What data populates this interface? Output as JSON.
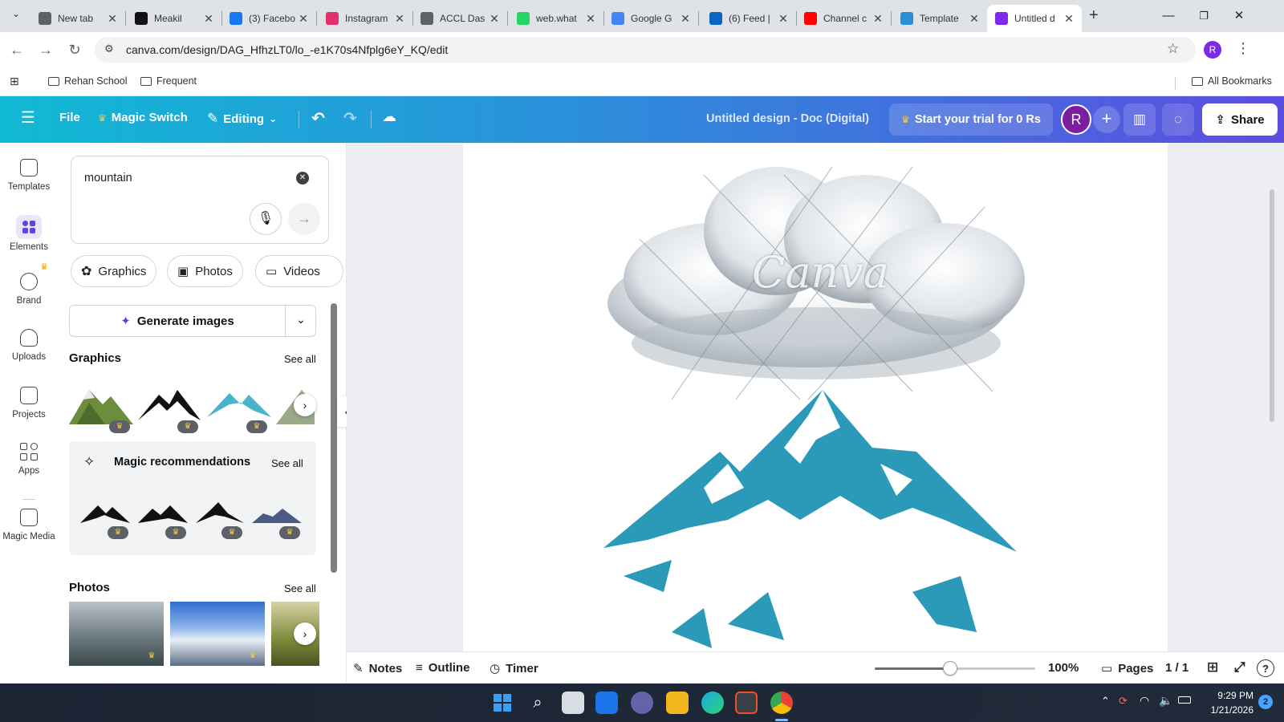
{
  "browser": {
    "tabs": [
      {
        "title": "New tab",
        "color": "#5f6368",
        "icon": "chrome-icon"
      },
      {
        "title": "Meakil",
        "color": "#111111",
        "icon": "meakil-icon"
      },
      {
        "title": "(3) Facebo",
        "color": "#1877f2",
        "icon": "facebook-icon"
      },
      {
        "title": "Instagram",
        "color": "#e1306c",
        "icon": "instagram-icon"
      },
      {
        "title": "ACCL Das",
        "color": "#5f6368",
        "icon": "globe-icon"
      },
      {
        "title": "web.what",
        "color": "#25d366",
        "icon": "whatsapp-icon"
      },
      {
        "title": "Google G",
        "color": "#4285f4",
        "icon": "gemini-icon"
      },
      {
        "title": "(6) Feed |",
        "color": "#0a66c2",
        "icon": "linkedin-icon"
      },
      {
        "title": "Channel c",
        "color": "#ff0000",
        "icon": "youtube-icon"
      },
      {
        "title": "Template",
        "color": "#2a8fd6",
        "icon": "canva-icon"
      },
      {
        "title": "Untitled d",
        "color": "#7d2ae8",
        "icon": "canva-doc-icon"
      }
    ],
    "url": "canva.com/design/DAG_HfhzLT0/lo_-e1K70s4Nfplg6eY_KQ/edit",
    "profile_letter": "R",
    "bookmarks": [
      "Rehan School",
      "Frequent"
    ],
    "all_bookmarks": "All Bookmarks"
  },
  "topbar": {
    "file": "File",
    "magic_switch": "Magic Switch",
    "editing": "Editing",
    "doc_title": "Untitled design - Doc (Digital)",
    "trial": "Start your trial for 0 Rs",
    "avatar": "R",
    "share": "Share"
  },
  "rail": [
    {
      "label": "Templates",
      "icon": "templates-icon"
    },
    {
      "label": "Elements",
      "icon": "elements-icon"
    },
    {
      "label": "Brand",
      "icon": "brand-icon"
    },
    {
      "label": "Uploads",
      "icon": "uploads-icon"
    },
    {
      "label": "Projects",
      "icon": "projects-icon"
    },
    {
      "label": "Apps",
      "icon": "apps-icon"
    },
    {
      "label": "Magic Media",
      "icon": "magic-media-icon"
    }
  ],
  "panel": {
    "search_value": "mountain",
    "chips": [
      "Graphics",
      "Photos",
      "Videos"
    ],
    "generate": "Generate images",
    "graphics_title": "Graphics",
    "see_all": "See all",
    "magic_title": "Magic recommendations",
    "photos_title": "Photos"
  },
  "canvas": {
    "watermark": "Canva"
  },
  "bottombar": {
    "notes": "Notes",
    "outline": "Outline",
    "timer": "Timer",
    "zoom": "100%",
    "zoom_level": 0.47,
    "pages": "Pages",
    "page_count": "1 / 1"
  },
  "taskbar": {
    "time": "9:29 PM",
    "date": "1/21/2026",
    "badge": "2"
  }
}
